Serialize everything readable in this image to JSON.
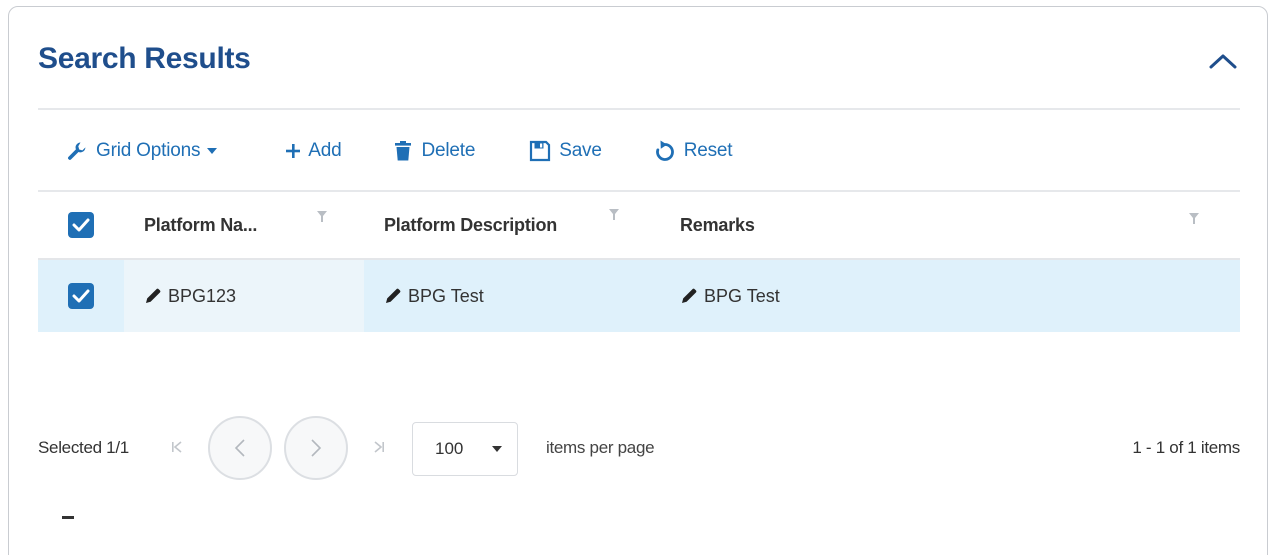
{
  "panel": {
    "title": "Search Results",
    "collapse_icon": "chevron-up-icon"
  },
  "toolbar": {
    "grid_options_label": "Grid Options",
    "add_label": "Add",
    "delete_label": "Delete",
    "save_label": "Save",
    "reset_label": "Reset"
  },
  "grid": {
    "columns": [
      {
        "key": "name",
        "label": "Platform Na..."
      },
      {
        "key": "description",
        "label": "Platform Description"
      },
      {
        "key": "remarks",
        "label": "Remarks"
      }
    ],
    "header_checked": true,
    "rows": [
      {
        "checked": true,
        "name": "BPG123",
        "description": "BPG Test",
        "remarks": "BPG Test"
      }
    ]
  },
  "pager": {
    "selected_text": "Selected 1/1",
    "page_size": "100",
    "items_per_page_label": "items per page",
    "range_text": "1 - 1 of 1 items"
  },
  "colors": {
    "title": "#1f4e8c",
    "accent": "#1f6fb5",
    "selected_row": "#dff1fb"
  }
}
